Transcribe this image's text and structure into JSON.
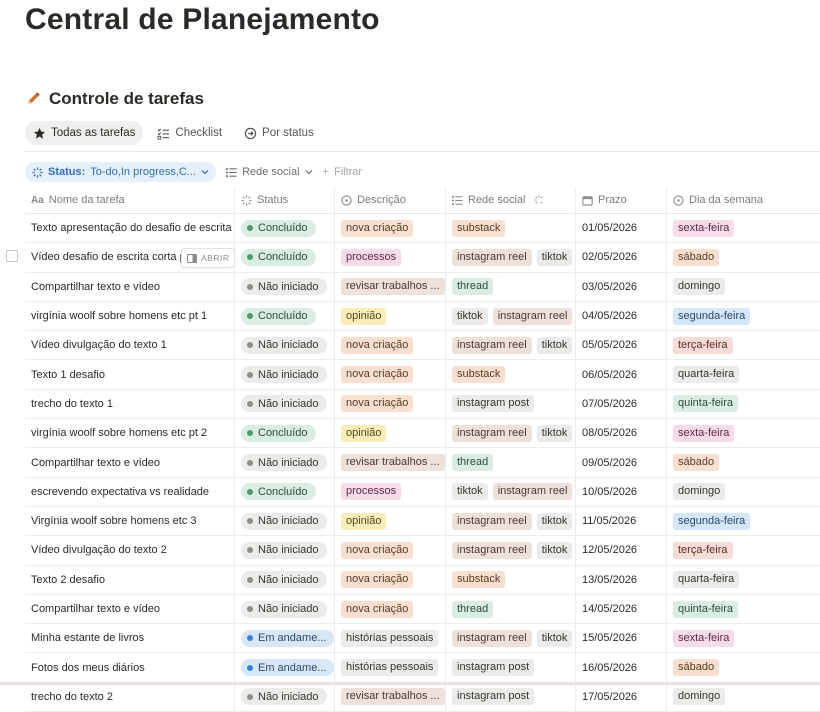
{
  "page": {
    "title": "Central de Planejamento"
  },
  "database": {
    "title": "Controle de tarefas",
    "icon": "pencil-icon"
  },
  "views": [
    {
      "label": "Todas as tarefas",
      "icon": "star-icon",
      "active": true
    },
    {
      "label": "Checklist",
      "icon": "checklist-icon",
      "active": false
    },
    {
      "label": "Por status",
      "icon": "status-arrow-icon",
      "active": false
    }
  ],
  "filters": {
    "status_label": "Status:",
    "status_value": "To-do,In progress,C...",
    "group_label": "Rede social",
    "add_filter": "Filtrar"
  },
  "columns": {
    "name": "Nome da tarefa",
    "status": "Status",
    "description": "Descrição",
    "social": "Rede social",
    "deadline": "Prazo",
    "weekday": "Dia da semana"
  },
  "open_button": "ABRIR",
  "colors": {
    "orange": "#f7e0cf",
    "pink": "#f6dbe9",
    "gray": "#ebebea",
    "yellow": "#f9eeb8",
    "green": "#dbece2",
    "blue": "#d4e6f7",
    "red": "#f8dcd8",
    "purple": "#eae1f4",
    "brown": "#eee0da"
  },
  "rows": [
    {
      "name": "Texto apresentação do desafio de escrita",
      "status": "Concluído",
      "st": "done",
      "desc": "nova criação",
      "desc_c": "orange",
      "social": [
        [
          "substack",
          "orange"
        ]
      ],
      "date": "01/05/2026",
      "day": "sexta-feira",
      "day_c": "pink"
    },
    {
      "name": "Vídeo desafio de escrita corta p",
      "status": "Concluído",
      "st": "done",
      "desc": "processos",
      "desc_c": "pink",
      "social": [
        [
          "instagram reel",
          "brown"
        ],
        [
          "tiktok",
          "gray"
        ]
      ],
      "date": "02/05/2026",
      "day": "sábado",
      "day_c": "orange"
    },
    {
      "name": "Compartilhar texto e vídeo",
      "status": "Não iniciado",
      "st": "todo",
      "desc": "revisar trabalhos ...",
      "desc_c": "brown",
      "social": [
        [
          "thread",
          "green"
        ]
      ],
      "date": "03/05/2026",
      "day": "domingo",
      "day_c": "gray"
    },
    {
      "name": "virgínia woolf sobre homens etc pt 1",
      "status": "Concluído",
      "st": "done",
      "desc": "opinião",
      "desc_c": "yellow",
      "social": [
        [
          "tiktok",
          "gray"
        ],
        [
          "instagram reel",
          "brown"
        ]
      ],
      "date": "04/05/2026",
      "day": "segunda-feira",
      "day_c": "blue"
    },
    {
      "name": "Vídeo divulgação do texto 1",
      "status": "Não iniciado",
      "st": "todo",
      "desc": "nova criação",
      "desc_c": "orange",
      "social": [
        [
          "instagram reel",
          "brown"
        ],
        [
          "tiktok",
          "gray"
        ]
      ],
      "date": "05/05/2026",
      "day": "terça-feira",
      "day_c": "red"
    },
    {
      "name": "Texto 1 desafio",
      "status": "Não iniciado",
      "st": "todo",
      "desc": "nova criação",
      "desc_c": "orange",
      "social": [
        [
          "substack",
          "orange"
        ]
      ],
      "date": "06/05/2026",
      "day": "quarta-feira",
      "day_c": "gray"
    },
    {
      "name": "trecho do texto 1",
      "status": "Não iniciado",
      "st": "todo",
      "desc": "nova criação",
      "desc_c": "orange",
      "social": [
        [
          "instagram post",
          "gray"
        ]
      ],
      "date": "07/05/2026",
      "day": "quinta-feira",
      "day_c": "green"
    },
    {
      "name": "virgínia woolf sobre homens etc pt 2",
      "status": "Concluído",
      "st": "done",
      "desc": "opinião",
      "desc_c": "yellow",
      "social": [
        [
          "instagram reel",
          "brown"
        ],
        [
          "tiktok",
          "gray"
        ]
      ],
      "date": "08/05/2026",
      "day": "sexta-feira",
      "day_c": "pink"
    },
    {
      "name": "Compartilhar texto e vídeo",
      "status": "Não iniciado",
      "st": "todo",
      "desc": "revisar trabalhos ...",
      "desc_c": "brown",
      "social": [
        [
          "thread",
          "green"
        ]
      ],
      "date": "09/05/2026",
      "day": "sábado",
      "day_c": "orange"
    },
    {
      "name": "escrevendo expectativa vs realidade",
      "status": "Concluído",
      "st": "done",
      "desc": "processos",
      "desc_c": "pink",
      "social": [
        [
          "tiktok",
          "gray"
        ],
        [
          "instagram reel",
          "brown"
        ]
      ],
      "date": "10/05/2026",
      "day": "domingo",
      "day_c": "gray"
    },
    {
      "name": "Virgínia woolf sobre homens etc 3",
      "status": "Não iniciado",
      "st": "todo",
      "desc": "opinião",
      "desc_c": "yellow",
      "social": [
        [
          "instagram reel",
          "brown"
        ],
        [
          "tiktok",
          "gray"
        ]
      ],
      "date": "11/05/2026",
      "day": "segunda-feira",
      "day_c": "blue"
    },
    {
      "name": "Vídeo divulgação do texto 2",
      "status": "Não iniciado",
      "st": "todo",
      "desc": "nova criação",
      "desc_c": "orange",
      "social": [
        [
          "instagram reel",
          "brown"
        ],
        [
          "tiktok",
          "gray"
        ]
      ],
      "date": "12/05/2026",
      "day": "terça-feira",
      "day_c": "red"
    },
    {
      "name": "Texto 2 desafio",
      "status": "Não iniciado",
      "st": "todo",
      "desc": "nova criação",
      "desc_c": "orange",
      "social": [
        [
          "substack",
          "orange"
        ]
      ],
      "date": "13/05/2026",
      "day": "quarta-feira",
      "day_c": "gray"
    },
    {
      "name": "Compartilhar texto e vídeo",
      "status": "Não iniciado",
      "st": "todo",
      "desc": "nova criação",
      "desc_c": "orange",
      "social": [
        [
          "thread",
          "green"
        ]
      ],
      "date": "14/05/2026",
      "day": "quinta-feira",
      "day_c": "green"
    },
    {
      "name": "Minha estante de livros",
      "status": "Em andame...",
      "st": "prog",
      "desc": "histórias pessoais",
      "desc_c": "gray",
      "social": [
        [
          "instagram reel",
          "brown"
        ],
        [
          "tiktok",
          "gray"
        ]
      ],
      "date": "15/05/2026",
      "day": "sexta-feira",
      "day_c": "pink"
    },
    {
      "name": "Fotos dos meus diários",
      "status": "Em andame...",
      "st": "prog",
      "desc": "histórias pessoais",
      "desc_c": "gray",
      "social": [
        [
          "instagram post",
          "gray"
        ]
      ],
      "date": "16/05/2026",
      "day": "sábado",
      "day_c": "orange"
    },
    {
      "name": "trecho do texto 2",
      "status": "Não iniciado",
      "st": "todo",
      "desc": "revisar trabalhos ...",
      "desc_c": "brown",
      "social": [
        [
          "instagram post",
          "gray"
        ]
      ],
      "date": "17/05/2026",
      "day": "domingo",
      "day_c": "gray"
    }
  ]
}
